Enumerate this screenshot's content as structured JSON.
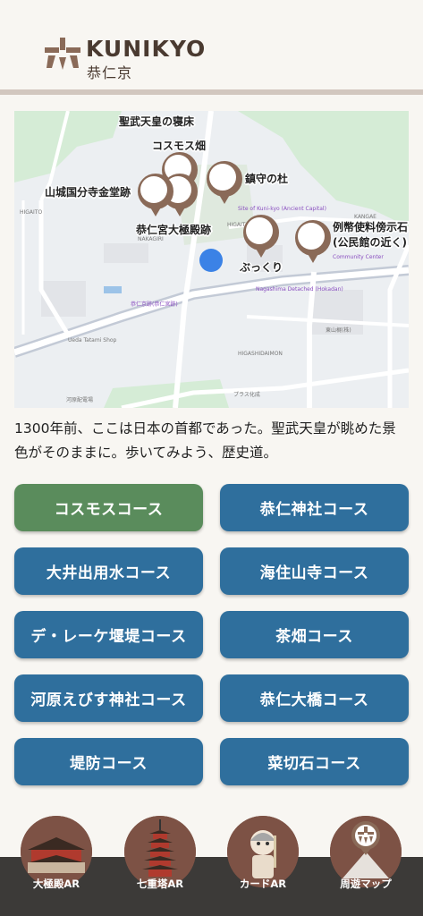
{
  "header": {
    "brand": "KUNIKYO",
    "brand_sub": "恭仁京",
    "logo_icon": "kuni-logo-icon"
  },
  "map": {
    "pins": [
      {
        "label": "聖武天皇の寝床"
      },
      {
        "label": "コスモス畑"
      },
      {
        "label": "鎮守の杜"
      },
      {
        "label": "山城国分寺金堂跡"
      },
      {
        "label": "恭仁宮大極殿跡"
      },
      {
        "label": "ぶっくり"
      },
      {
        "label": "例幣使料傍示石\n(公民館の近く)"
      }
    ],
    "place_labels": {
      "higaito": "HIGAITO",
      "nakagiri": "NAKAGIRI",
      "kangae": "KANGAE",
      "kuni_site": "Site of Kuni-kyo\n(Ancient Capital)",
      "higaito2": "HIGAITO",
      "nagashima": "Nagashima\nDetached (Hokadan)",
      "higashidaimon": "HIGASHIDAIMON",
      "tatami": "Ueda Tatami Shop",
      "community": "Community Center",
      "plus": "プラス化成",
      "kanzan": "瓶原郵便局",
      "hospital": "東山梶(株)",
      "park": "河原配電場",
      "bus_stop": "恭仁京跡(恭仁宮跡)"
    }
  },
  "intro": "1300年前、ここは日本の首都であった。聖武天皇が眺めた景色がそのままに。歩いてみよう、歴史道。",
  "courses": [
    {
      "label": "コスモスコース",
      "active": true
    },
    {
      "label": "恭仁神社コース"
    },
    {
      "label": "大井出用水コース"
    },
    {
      "label": "海住山寺コース"
    },
    {
      "label": "デ・レーケ堰堤コース"
    },
    {
      "label": "茶畑コース"
    },
    {
      "label": "河原えびす神社コース"
    },
    {
      "label": "恭仁大橋コース"
    },
    {
      "label": "堤防コース"
    },
    {
      "label": "菜切石コース"
    }
  ],
  "nav": [
    {
      "label": "大極殿AR",
      "icon": "daigokuden-icon"
    },
    {
      "label": "七重塔AR",
      "icon": "pagoda-icon"
    },
    {
      "label": "カードAR",
      "icon": "character-card-icon"
    },
    {
      "label": "周遊マップ",
      "icon": "map-icon"
    }
  ],
  "colors": {
    "course_blue": "#2f6f9d",
    "course_active": "#5a8c5c",
    "pin_brown": "#8a6a58",
    "nav_bg": "#3c3a38",
    "user_dot": "#3b82e6"
  }
}
